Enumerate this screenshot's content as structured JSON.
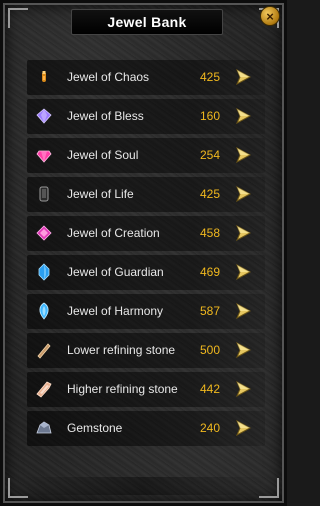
{
  "window": {
    "title": "Jewel Bank",
    "close_label": "×"
  },
  "colors": {
    "count": "#f0b81e",
    "name": "#e8e8e8",
    "arrow": "#e6c760"
  },
  "jewels": [
    {
      "name": "Jewel of Chaos",
      "count": "425",
      "icon": "chaos-jewel-icon"
    },
    {
      "name": "Jewel of Bless",
      "count": "160",
      "icon": "bless-jewel-icon"
    },
    {
      "name": "Jewel of Soul",
      "count": "254",
      "icon": "soul-jewel-icon"
    },
    {
      "name": "Jewel of Life",
      "count": "425",
      "icon": "life-jewel-icon"
    },
    {
      "name": "Jewel of Creation",
      "count": "458",
      "icon": "creation-jewel-icon"
    },
    {
      "name": "Jewel of Guardian",
      "count": "469",
      "icon": "guardian-jewel-icon"
    },
    {
      "name": "Jewel of Harmony",
      "count": "587",
      "icon": "harmony-jewel-icon"
    },
    {
      "name": "Lower refining stone",
      "count": "500",
      "icon": "lower-refining-stone-icon"
    },
    {
      "name": "Higher refining stone",
      "count": "442",
      "icon": "higher-refining-stone-icon"
    },
    {
      "name": "Gemstone",
      "count": "240",
      "icon": "gemstone-icon"
    }
  ]
}
